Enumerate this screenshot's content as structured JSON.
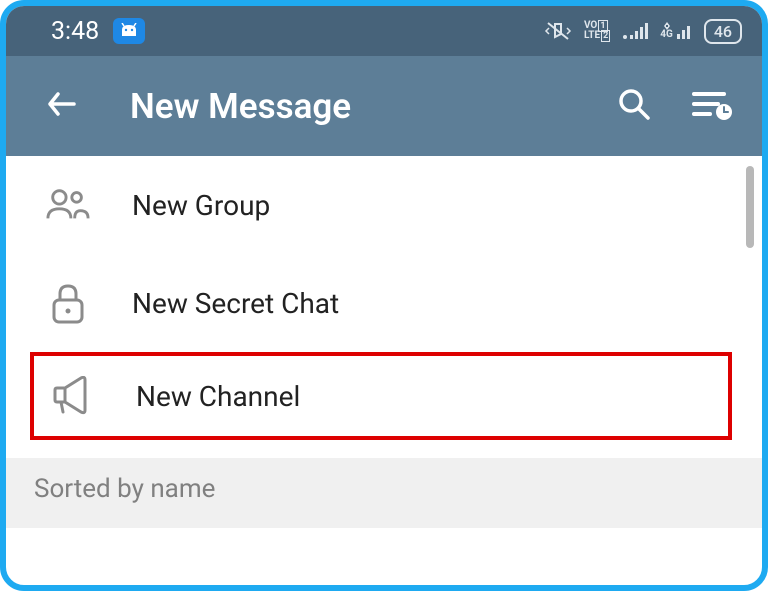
{
  "status_bar": {
    "time": "3:48",
    "battery": "46",
    "network": "4G",
    "volte": "VO LTE"
  },
  "app_bar": {
    "title": "New Message"
  },
  "menu": {
    "items": [
      {
        "label": "New Group"
      },
      {
        "label": "New Secret Chat"
      },
      {
        "label": "New Channel"
      }
    ]
  },
  "sort": {
    "label": "Sorted by name"
  }
}
